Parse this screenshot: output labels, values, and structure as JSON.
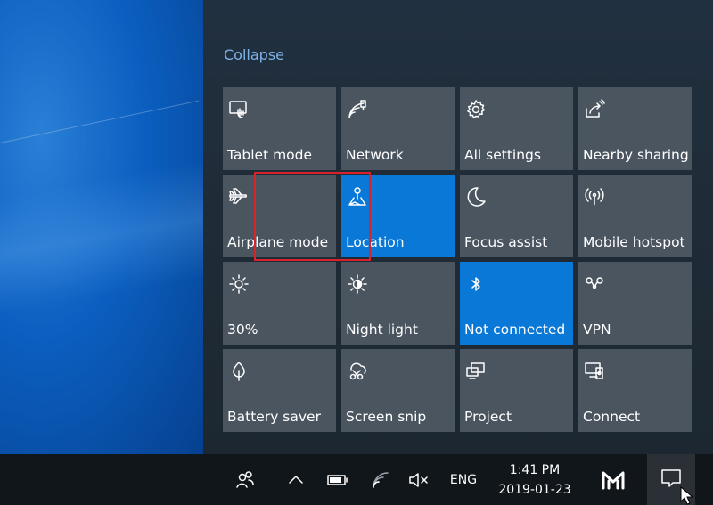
{
  "action_center": {
    "collapse_label": "Collapse",
    "tiles": [
      {
        "label": "Tablet mode",
        "icon": "tablet-mode-icon",
        "active": false
      },
      {
        "label": "Network",
        "icon": "network-icon",
        "active": false
      },
      {
        "label": "All settings",
        "icon": "settings-gear-icon",
        "active": false
      },
      {
        "label": "Nearby sharing",
        "icon": "nearby-sharing-icon",
        "active": false
      },
      {
        "label": "Airplane mode",
        "icon": "airplane-icon",
        "active": false
      },
      {
        "label": "Location",
        "icon": "location-icon",
        "active": true
      },
      {
        "label": "Focus assist",
        "icon": "moon-icon",
        "active": false
      },
      {
        "label": "Mobile hotspot",
        "icon": "hotspot-icon",
        "active": false
      },
      {
        "label": "30%",
        "icon": "brightness-icon",
        "active": false
      },
      {
        "label": "Night light",
        "icon": "night-light-icon",
        "active": false
      },
      {
        "label": "Not connected",
        "icon": "bluetooth-icon",
        "active": true
      },
      {
        "label": "VPN",
        "icon": "vpn-icon",
        "active": false
      },
      {
        "label": "Battery saver",
        "icon": "battery-saver-icon",
        "active": false
      },
      {
        "label": "Screen snip",
        "icon": "screen-snip-icon",
        "active": false
      },
      {
        "label": "Project",
        "icon": "project-icon",
        "active": false
      },
      {
        "label": "Connect",
        "icon": "connect-icon",
        "active": false
      }
    ],
    "colors": {
      "tile": "#4a5560",
      "tile_active": "#0a78d7",
      "highlight": "#d8232a",
      "link": "#7fb2e5"
    }
  },
  "taskbar": {
    "language": "ENG",
    "time": "1:41 PM",
    "date": "2019-01-23",
    "icons": [
      "people-icon",
      "chevron-up-icon",
      "battery-icon",
      "wifi-icon",
      "volume-muted-icon",
      "app-logo-icon",
      "notification-icon"
    ]
  }
}
